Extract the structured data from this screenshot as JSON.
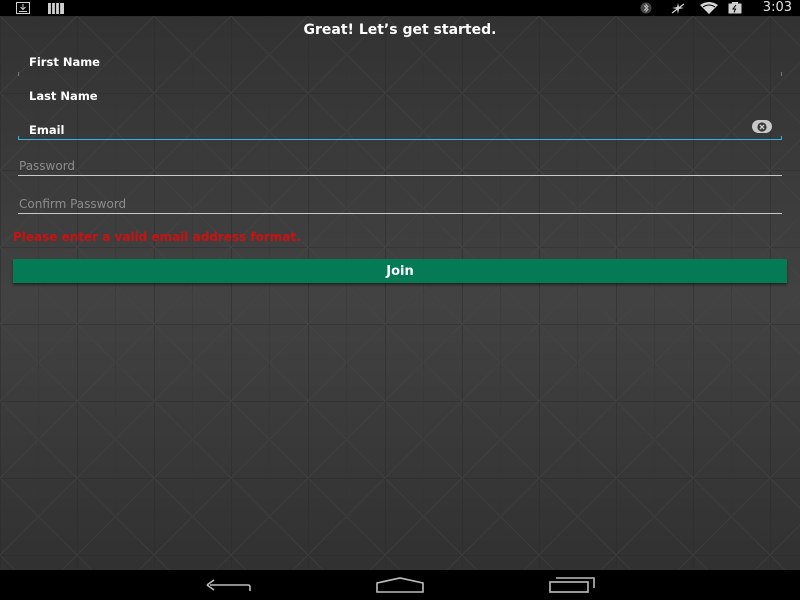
{
  "status_bar": {
    "time": "3:03",
    "left_icons": [
      "download-icon",
      "signal-bars-icon"
    ],
    "right_icons": [
      "bluetooth-icon",
      "airplane-mode-icon",
      "wifi-icon",
      "battery-icon"
    ]
  },
  "header": {
    "title": "Great! Let’s get started."
  },
  "form": {
    "first_name": {
      "label": "First Name",
      "value": ""
    },
    "last_name": {
      "label": "Last Name",
      "value": ""
    },
    "email": {
      "label": "Email",
      "value": "",
      "focused": true,
      "clear_icon": "clear-text-icon"
    },
    "password": {
      "placeholder": "Password",
      "value": ""
    },
    "confirm_password": {
      "placeholder": "Confirm Password",
      "value": ""
    },
    "error": "Please enter a valid email address format.",
    "submit_label": "Join"
  },
  "nav_bar": {
    "icons": [
      "back-icon",
      "home-icon",
      "recent-apps-icon"
    ]
  },
  "colors": {
    "accent_focus": "#33b5e5",
    "error": "#cc1111",
    "button": "#047a55",
    "background": "#3c3c3c"
  }
}
